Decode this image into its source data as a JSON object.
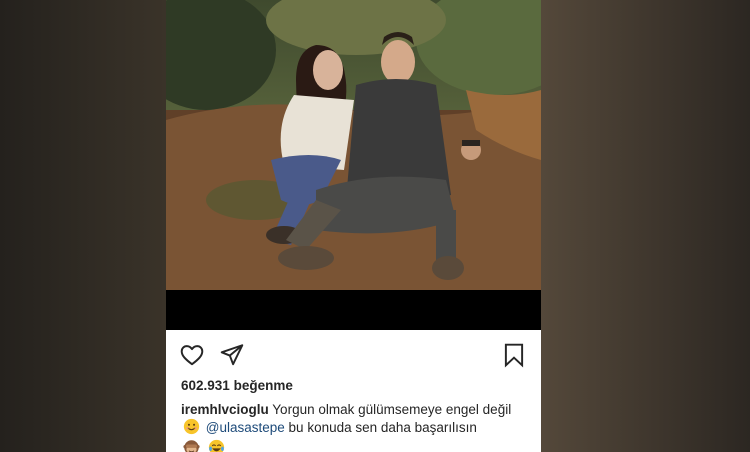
{
  "post": {
    "likes_count": "602.931",
    "likes_label": "beğenme",
    "caption": {
      "username": "iremhlvcioglu",
      "text_part1": "Yorgun olmak gülümsemeye engel değil",
      "mention": "@ulasastepe",
      "text_part2": "bu konuda sen daha başarılısın"
    }
  },
  "icons": {
    "like": "heart-icon",
    "share": "paper-plane-icon",
    "save": "bookmark-icon",
    "emojis": [
      "smiling-face-emoji",
      "see-no-evil-monkey-emoji",
      "tears-of-joy-emoji"
    ]
  },
  "colors": {
    "text": "#262626",
    "mention": "#1e4b7a",
    "band": "#000000"
  }
}
